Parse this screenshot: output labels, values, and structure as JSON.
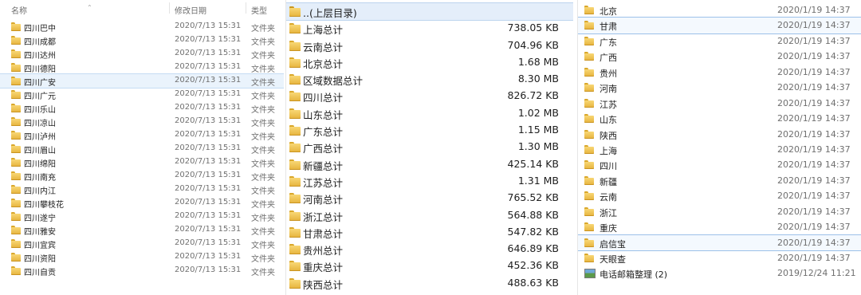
{
  "left_panel": {
    "headers": {
      "name": "名称",
      "modified": "修改日期",
      "type": "类型"
    },
    "rows": [
      {
        "name": "四川巴中",
        "date": "2020/7/13 15:31",
        "type": "文件夹"
      },
      {
        "name": "四川成都",
        "date": "2020/7/13 15:31",
        "type": "文件夹"
      },
      {
        "name": "四川达州",
        "date": "2020/7/13 15:31",
        "type": "文件夹"
      },
      {
        "name": "四川德阳",
        "date": "2020/7/13 15:31",
        "type": "文件夹"
      },
      {
        "name": "四川广安",
        "date": "2020/7/13 15:31",
        "type": "文件夹",
        "selected": true
      },
      {
        "name": "四川广元",
        "date": "2020/7/13 15:31",
        "type": "文件夹"
      },
      {
        "name": "四川乐山",
        "date": "2020/7/13 15:31",
        "type": "文件夹"
      },
      {
        "name": "四川凉山",
        "date": "2020/7/13 15:31",
        "type": "文件夹"
      },
      {
        "name": "四川泸州",
        "date": "2020/7/13 15:31",
        "type": "文件夹"
      },
      {
        "name": "四川眉山",
        "date": "2020/7/13 15:31",
        "type": "文件夹"
      },
      {
        "name": "四川绵阳",
        "date": "2020/7/13 15:31",
        "type": "文件夹"
      },
      {
        "name": "四川南充",
        "date": "2020/7/13 15:31",
        "type": "文件夹"
      },
      {
        "name": "四川内江",
        "date": "2020/7/13 15:31",
        "type": "文件夹"
      },
      {
        "name": "四川攀枝花",
        "date": "2020/7/13 15:31",
        "type": "文件夹"
      },
      {
        "name": "四川遂宁",
        "date": "2020/7/13 15:31",
        "type": "文件夹"
      },
      {
        "name": "四川雅安",
        "date": "2020/7/13 15:31",
        "type": "文件夹"
      },
      {
        "name": "四川宜宾",
        "date": "2020/7/13 15:31",
        "type": "文件夹"
      },
      {
        "name": "四川资阳",
        "date": "2020/7/13 15:31",
        "type": "文件夹"
      },
      {
        "name": "四川自贡",
        "date": "2020/7/13 15:31",
        "type": "文件夹"
      }
    ]
  },
  "middle_panel": {
    "rows": [
      {
        "name": "..(上层目录)",
        "size": "",
        "up": true,
        "selected": true
      },
      {
        "name": "上海总计",
        "size": "738.05 KB"
      },
      {
        "name": "云南总计",
        "size": "704.96 KB"
      },
      {
        "name": "北京总计",
        "size": "1.68 MB"
      },
      {
        "name": "区域数据总计",
        "size": "8.30 MB"
      },
      {
        "name": "四川总计",
        "size": "826.72 KB"
      },
      {
        "name": "山东总计",
        "size": "1.02 MB"
      },
      {
        "name": "广东总计",
        "size": "1.15 MB"
      },
      {
        "name": "广西总计",
        "size": "1.30 MB"
      },
      {
        "name": "新疆总计",
        "size": "425.14 KB"
      },
      {
        "name": "江苏总计",
        "size": "1.31 MB"
      },
      {
        "name": "河南总计",
        "size": "765.52 KB"
      },
      {
        "name": "浙江总计",
        "size": "564.88 KB"
      },
      {
        "name": "甘肃总计",
        "size": "547.82 KB"
      },
      {
        "name": "贵州总计",
        "size": "646.89 KB"
      },
      {
        "name": "重庆总计",
        "size": "452.36 KB"
      },
      {
        "name": "陕西总计",
        "size": "488.63 KB"
      }
    ]
  },
  "right_panel": {
    "rows": [
      {
        "name": "北京",
        "date": "2020/1/19 14:37",
        "icon": "folder"
      },
      {
        "name": "甘肃",
        "date": "2020/1/19 14:37",
        "icon": "folder",
        "selected": true
      },
      {
        "name": "广东",
        "date": "2020/1/19 14:37",
        "icon": "folder"
      },
      {
        "name": "广西",
        "date": "2020/1/19 14:37",
        "icon": "folder"
      },
      {
        "name": "贵州",
        "date": "2020/1/19 14:37",
        "icon": "folder"
      },
      {
        "name": "河南",
        "date": "2020/1/19 14:37",
        "icon": "folder"
      },
      {
        "name": "江苏",
        "date": "2020/1/19 14:37",
        "icon": "folder"
      },
      {
        "name": "山东",
        "date": "2020/1/19 14:37",
        "icon": "folder"
      },
      {
        "name": "陕西",
        "date": "2020/1/19 14:37",
        "icon": "folder"
      },
      {
        "name": "上海",
        "date": "2020/1/19 14:37",
        "icon": "folder"
      },
      {
        "name": "四川",
        "date": "2020/1/19 14:37",
        "icon": "folder"
      },
      {
        "name": "新疆",
        "date": "2020/1/19 14:37",
        "icon": "folder"
      },
      {
        "name": "云南",
        "date": "2020/1/19 14:37",
        "icon": "folder"
      },
      {
        "name": "浙江",
        "date": "2020/1/19 14:37",
        "icon": "folder"
      },
      {
        "name": "重庆",
        "date": "2020/1/19 14:37",
        "icon": "folder"
      },
      {
        "name": "启信宝",
        "date": "2020/1/19 14:37",
        "icon": "folder",
        "selected": true
      },
      {
        "name": "天眼查",
        "date": "2020/1/19 14:37",
        "icon": "folder"
      },
      {
        "name": "电话邮箱整理 (2)",
        "date": "2019/12/24 11:21",
        "icon": "image"
      }
    ]
  }
}
